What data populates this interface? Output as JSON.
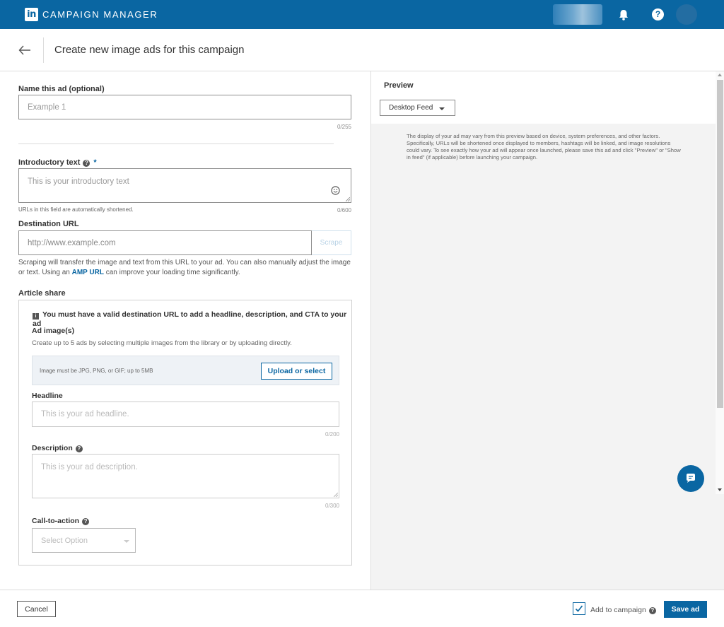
{
  "app": {
    "brand_logo": "in",
    "brand_name": "CAMPAIGN MANAGER",
    "accent": "#0a66a2"
  },
  "topbar": {
    "notifications_icon": "bell-icon",
    "help_label": "?"
  },
  "header": {
    "title": "Create new image ads for this campaign"
  },
  "form": {
    "name_label": "Name this ad (optional)",
    "name_placeholder": "Example 1",
    "name_counter": "0/255",
    "intro_label": "Introductory text",
    "required_mark": "*",
    "intro_placeholder": "This is your introductory text",
    "intro_hint": "URLs in this field are automatically shortened.",
    "intro_counter": "0/600",
    "dest_label": "Destination URL",
    "dest_placeholder": "http://www.example.com",
    "scrape_label": "Scrape",
    "scrape_text_1": "Scraping will transfer the image and text from this URL to your ad. You can also manually adjust the image or text. Using an ",
    "amp_link": "AMP URL",
    "scrape_text_2": " can improve your loading time significantly.",
    "article_label": "Article share",
    "article": {
      "notice": "You must have a valid destination URL to add a headline, description, and CTA to your ad",
      "ad_images_label": "Ad image(s)",
      "ad_images_hint": "Create up to 5 ads by selecting multiple images from the library or by uploading directly.",
      "upload_hint": "Image must be JPG, PNG, or GIF; up to 5MB",
      "upload_button": "Upload or select",
      "headline_label": "Headline",
      "headline_placeholder": "This is your ad headline.",
      "headline_counter": "0/200",
      "description_label": "Description",
      "description_placeholder": "This is your ad description.",
      "description_counter": "0/300",
      "cta_label": "Call-to-action",
      "cta_placeholder": "Select Option"
    }
  },
  "preview": {
    "title": "Preview",
    "feed_selected": "Desktop Feed",
    "note": "The display of your ad may vary from this preview based on device, system preferences, and other factors. Specifically, URLs will be shortened once displayed to members, hashtags will be linked, and image resolutions could vary. To see exactly how your ad will appear once launched, please save this ad and click \"Preview\" or \"Show in feed\" (if applicable) before launching your campaign."
  },
  "footer": {
    "cancel_label": "Cancel",
    "add_to_campaign_label": "Add to campaign",
    "add_to_campaign_checked": true,
    "save_label": "Save ad"
  }
}
